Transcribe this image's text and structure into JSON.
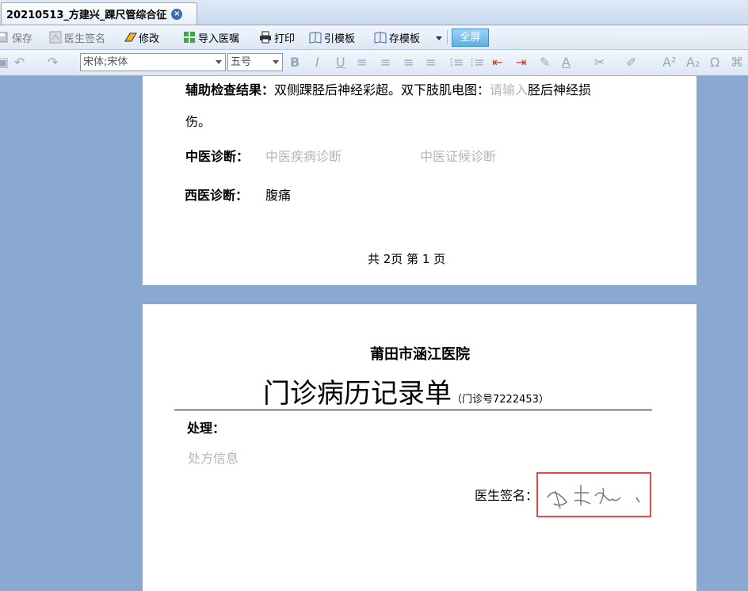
{
  "tab": {
    "title": "20210513_方建兴_踝尺管综合征"
  },
  "toolbar": {
    "save": "保存",
    "doctor_sign": "医生签名",
    "edit": "修改",
    "import_order": "导入医嘱",
    "print": "打印",
    "use_template": "引模板",
    "save_template": "存模板",
    "fullscreen": "全屏"
  },
  "format_bar": {
    "font_family": "宋体;宋体",
    "font_size": "五号"
  },
  "page1": {
    "aux_label": "辅助检查结果：",
    "aux_text_a": "双侧踝胫后神经彩超。双下肢肌电图：",
    "aux_placeholder": "请输入",
    "aux_text_b": "胫后神经损",
    "aux_text_c": "伤。",
    "tcm_label": "中医诊断：",
    "tcm_disease_placeholder": "中医疾病诊断",
    "tcm_syndrome_placeholder": "中医证候诊断",
    "wm_label": "西医诊断：",
    "wm_value": "腹痛",
    "page_footer": "共 2页   第  1  页"
  },
  "page2": {
    "hospital": "莆田市涵江医院",
    "record_title": "门诊病历记录单",
    "record_no": "（门诊号7222453）",
    "treatment_label": "处理：",
    "prescription_placeholder": "处方信息",
    "doctor_sign_label": "医生签名：",
    "signature_text": "方建兴"
  }
}
